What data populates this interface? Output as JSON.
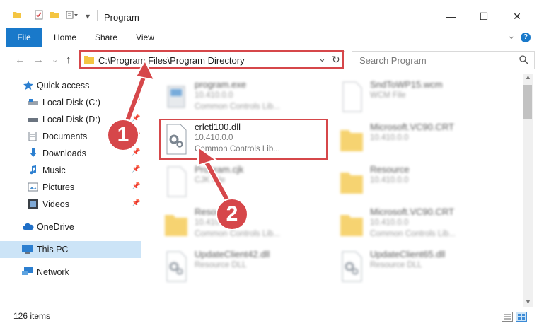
{
  "window": {
    "title": "Program",
    "minimize_glyph": "—",
    "maximize_glyph": "☐",
    "close_glyph": "✕"
  },
  "ribbon": {
    "tabs": [
      "File",
      "Home",
      "Share",
      "View"
    ],
    "expand_glyph": "⌄",
    "help_glyph": "?"
  },
  "navigation": {
    "back_glyph": "←",
    "forward_glyph": "→",
    "recent_glyph": "⌄",
    "up_glyph": "↑",
    "address": "C:\\Program Files\\Program Directory",
    "dropdown_glyph": "⌄",
    "refresh_glyph": "↻",
    "search_placeholder": "Search Program"
  },
  "sidebar": {
    "items": [
      {
        "label": "Quick access",
        "icon": "star-icon",
        "pinned": false
      },
      {
        "label": "Local Disk (C:)",
        "icon": "drive-icon",
        "pinned": true
      },
      {
        "label": "Local Disk (D:)",
        "icon": "drive-icon",
        "pinned": true
      },
      {
        "label": "Documents",
        "icon": "documents-icon",
        "pinned": true
      },
      {
        "label": "Downloads",
        "icon": "downloads-icon",
        "pinned": true
      },
      {
        "label": "Music",
        "icon": "music-icon",
        "pinned": true
      },
      {
        "label": "Pictures",
        "icon": "pictures-icon",
        "pinned": true
      },
      {
        "label": "Videos",
        "icon": "videos-icon",
        "pinned": true
      },
      {
        "label": "OneDrive",
        "icon": "onedrive-icon",
        "pinned": false
      },
      {
        "label": "This PC",
        "icon": "computer-icon",
        "pinned": false,
        "selected": true
      },
      {
        "label": "Network",
        "icon": "network-icon",
        "pinned": false
      }
    ],
    "pin_glyph": "📌"
  },
  "files": [
    {
      "name": "program.exe",
      "version": "10.410.0.0",
      "description": "Common Controls Lib...",
      "icon": "exe-icon"
    },
    {
      "name": "SndToWP15.wcm",
      "version": "WCM File",
      "description": "",
      "icon": "blank-file-icon"
    },
    {
      "name": "crlctl100.dll",
      "version": "10.410.0.0",
      "description": "Common Controls Lib...",
      "icon": "dll-icon",
      "highlighted": true
    },
    {
      "name": "Microsoft.VC90.CRT",
      "version": "10.410.0.0",
      "description": "",
      "icon": "folder-icon"
    },
    {
      "name": "Program.cjk",
      "version": "CJK File",
      "description": "",
      "icon": "blank-file-icon"
    },
    {
      "name": "Resource",
      "version": "10.410.0.0",
      "description": "",
      "icon": "folder-icon"
    },
    {
      "name": "Resource",
      "version": "10.410.0.0",
      "description": "Common Controls Lib...",
      "icon": "folder-icon"
    },
    {
      "name": "Microsoft.VC90.CRT",
      "version": "10.410.0.0",
      "description": "Common Controls Lib...",
      "icon": "folder-icon"
    },
    {
      "name": "UpdateClient42.dll",
      "version": "Resource DLL",
      "description": "",
      "icon": "dll-icon"
    },
    {
      "name": "UpdateClient65.dll",
      "version": "Resource DLL",
      "description": "",
      "icon": "dll-icon"
    }
  ],
  "status": {
    "item_count": "126 items"
  },
  "callouts": [
    "1",
    "2"
  ],
  "colors": {
    "accent": "#1979ca",
    "highlight": "#d6474a",
    "selection": "#cce4f7",
    "folder": "#f4c542"
  }
}
